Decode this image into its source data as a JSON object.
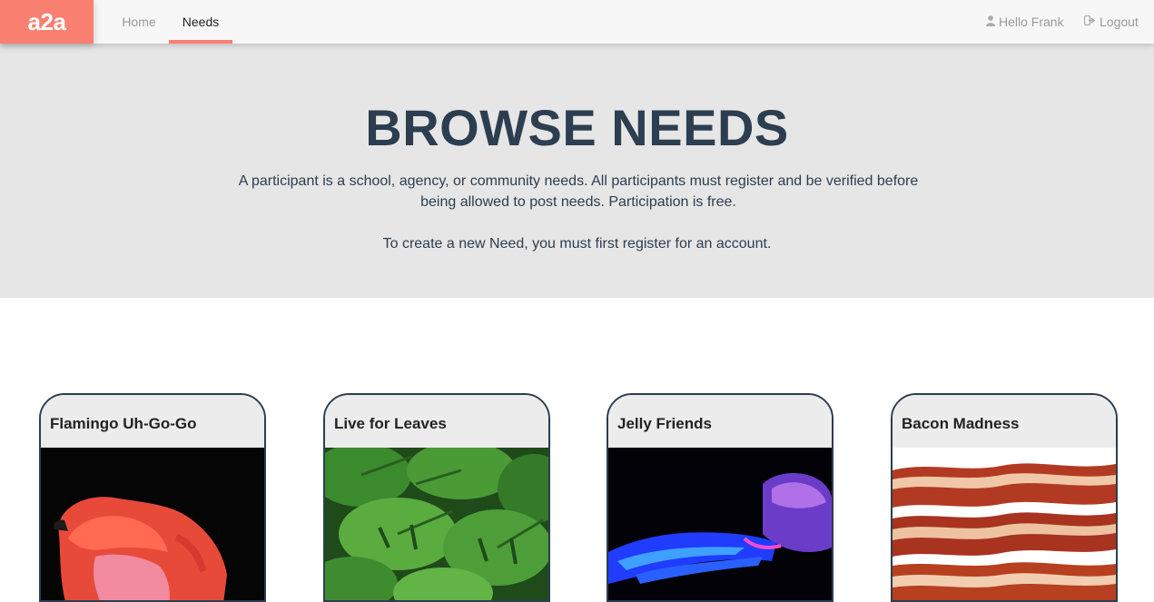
{
  "nav": {
    "brand": "a2a",
    "links": [
      {
        "label": "Home",
        "active": false
      },
      {
        "label": "Needs",
        "active": true
      }
    ],
    "user": {
      "icon": "user-icon",
      "label": "Hello Frank"
    },
    "logout": {
      "icon": "sign-out-icon",
      "label": "Logout"
    }
  },
  "hero": {
    "title": "BROWSE NEEDS",
    "description": "A participant is a school, agency, or community needs. All participants must register and be verified before being allowed to post needs. Participation is free.",
    "cta": "To create a new Need, you must first register for an account."
  },
  "needs": [
    {
      "title": "Flamingo Uh-Go-Go",
      "image": "flamingo-image"
    },
    {
      "title": "Live for Leaves",
      "image": "leaves-image"
    },
    {
      "title": "Jelly Friends",
      "image": "jellyfish-image"
    },
    {
      "title": "Bacon Madness",
      "image": "bacon-image"
    }
  ],
  "colors": {
    "accent": "#fa8072",
    "heading": "#2c3e50",
    "hero_bg": "#e6e6e6",
    "nav_bg": "#f7f7f7",
    "card_head_bg": "#ececec"
  }
}
